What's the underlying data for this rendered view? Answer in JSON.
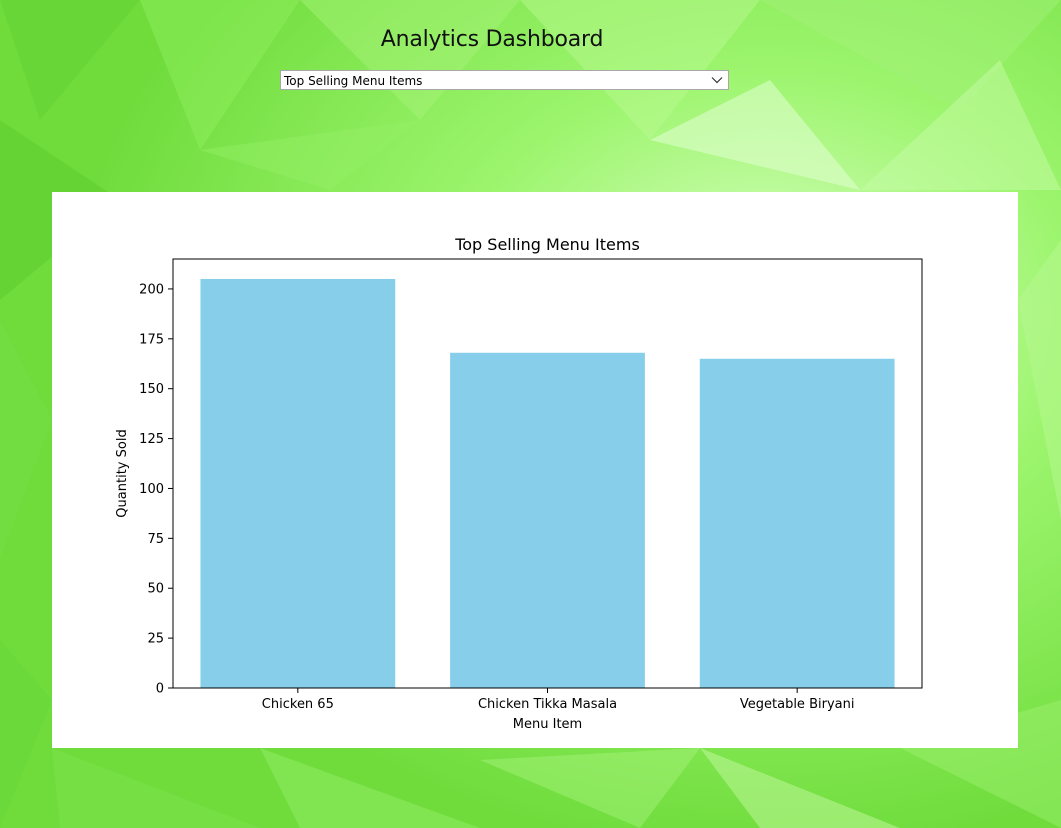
{
  "app": {
    "title": "Analytics Dashboard"
  },
  "report_select": {
    "selected": "Top Selling Menu Items",
    "icon": "chevron-down-icon"
  },
  "colors": {
    "background": "#7ee64a",
    "bar": "#87ceeb",
    "panel": "#ffffff"
  },
  "chart_data": {
    "type": "bar",
    "title": "Top Selling Menu Items",
    "xlabel": "Menu Item",
    "ylabel": "Quantity Sold",
    "categories": [
      "Chicken 65",
      "Chicken Tikka Masala",
      "Vegetable Biryani"
    ],
    "values": [
      205,
      168,
      165
    ],
    "ylim": [
      0,
      215
    ],
    "yticks": [
      0,
      25,
      50,
      75,
      100,
      125,
      150,
      175,
      200
    ],
    "grid": false,
    "legend": "none"
  }
}
